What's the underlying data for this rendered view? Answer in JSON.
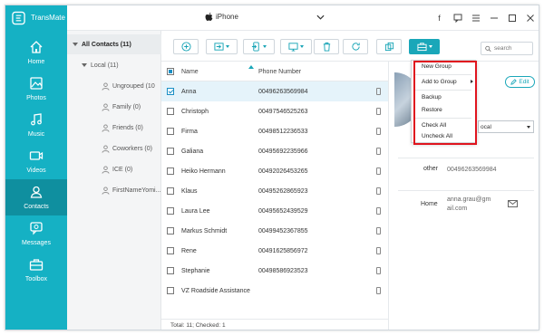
{
  "app": {
    "name": "TransMate",
    "device": "iPhone"
  },
  "nav": {
    "items": [
      {
        "label": "Home",
        "icon": "home-icon"
      },
      {
        "label": "Photos",
        "icon": "photos-icon"
      },
      {
        "label": "Music",
        "icon": "music-icon"
      },
      {
        "label": "Videos",
        "icon": "videos-icon"
      },
      {
        "label": "Contacts",
        "icon": "contacts-icon",
        "active": true
      },
      {
        "label": "Messages",
        "icon": "messages-icon"
      },
      {
        "label": "Toolbox",
        "icon": "toolbox-icon"
      }
    ]
  },
  "groups": {
    "header": "All Contacts",
    "header_count": "(11)",
    "local": "Local",
    "local_count": "(11)",
    "items": [
      {
        "label": "Ungrouped",
        "count": "(10"
      },
      {
        "label": "Family",
        "count": "(0)"
      },
      {
        "label": "Friends",
        "count": "(0)"
      },
      {
        "label": "Coworkers",
        "count": "(0)"
      },
      {
        "label": "ICE",
        "count": "(0)"
      },
      {
        "label": "FirstNameYomi...",
        "count": ""
      }
    ]
  },
  "search": {
    "placeholder": "search"
  },
  "list": {
    "col_name": "Name",
    "col_phone": "Phone Number",
    "rows": [
      {
        "name": "Anna",
        "phone": "00496263569984",
        "checked": true
      },
      {
        "name": "Christoph",
        "phone": "00497546525263",
        "checked": false
      },
      {
        "name": "Firma",
        "phone": "00498512236533",
        "checked": false
      },
      {
        "name": "Galiana",
        "phone": "00495692235966",
        "checked": false
      },
      {
        "name": "Heiko Hermann",
        "phone": "00492026453265",
        "checked": false
      },
      {
        "name": "Klaus",
        "phone": "00495262865923",
        "checked": false
      },
      {
        "name": "Laura Lee",
        "phone": "00495652439529",
        "checked": false
      },
      {
        "name": "Markus Schmidt",
        "phone": "00499452367855",
        "checked": false
      },
      {
        "name": "Rene",
        "phone": "00491625856972",
        "checked": false
      },
      {
        "name": "Stephanie",
        "phone": "00498586923523",
        "checked": false
      },
      {
        "name": "VZ Roadside Assistance",
        "phone": "",
        "checked": false
      }
    ],
    "status": "Total: 11; Checked: 1"
  },
  "detail": {
    "edit_label": "Edit",
    "source_value": "ocal",
    "other_label": "other",
    "other_value": "00496263569984",
    "home_label": "Home",
    "email_line1": "anna.grau@gm",
    "email_line2": "ail.com"
  },
  "menu": {
    "items": [
      "New Group",
      "Add to Group",
      "Backup",
      "Restore",
      "Check All",
      "Uncheck All"
    ]
  },
  "colors": {
    "accent": "#15b1c4",
    "nav_active": "#0f8f9f",
    "highlight": "#e0141e",
    "selected_row": "#e5f3fa"
  }
}
